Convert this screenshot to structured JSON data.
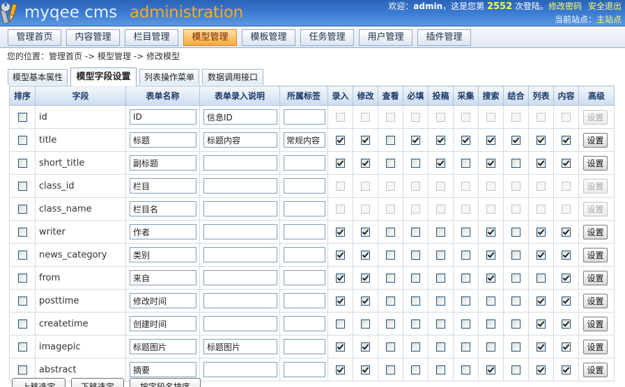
{
  "header": {
    "logo_icon": "tools-icon",
    "logo_main": "myqee cms",
    "logo_sub": "administration",
    "welcome_prefix": "欢迎：",
    "username": "admin",
    "welcome_mid": "，这是您第 ",
    "login_count": "2552",
    "welcome_suffix": " 次登陆。",
    "change_password": "修改密码",
    "logout": "安全退出",
    "site_label": "当前站点：",
    "site_name": "主站点"
  },
  "nav": {
    "tabs": [
      {
        "label": "管理首页",
        "active": false
      },
      {
        "label": "内容管理",
        "active": false
      },
      {
        "label": "栏目管理",
        "active": false
      },
      {
        "label": "模型管理",
        "active": true
      },
      {
        "label": "模板管理",
        "active": false
      },
      {
        "label": "任务管理",
        "active": false
      },
      {
        "label": "用户管理",
        "active": false
      },
      {
        "label": "插件管理",
        "active": false
      }
    ]
  },
  "breadcrumb": {
    "prefix": "您的位置：",
    "separator": " -> ",
    "items": [
      "管理首页",
      "模型管理",
      "修改模型"
    ]
  },
  "subtabs": [
    {
      "label": "模型基本属性",
      "active": false
    },
    {
      "label": "模型字段设置",
      "active": true
    },
    {
      "label": "列表操作菜单",
      "active": false
    },
    {
      "label": "数据调用接口",
      "active": false
    }
  ],
  "table": {
    "headers": [
      "排序",
      "字段",
      "表单名称",
      "表单录入说明",
      "所属标签",
      "录入",
      "修改",
      "查看",
      "必填",
      "投稿",
      "采集",
      "搜索",
      "结合",
      "列表",
      "内容",
      "高级"
    ],
    "settings_label": "设置",
    "rows": [
      {
        "field": "id",
        "form_name": "ID",
        "form_desc": "信息ID",
        "tag": "",
        "locked": true,
        "flags": [
          false,
          false,
          false,
          false,
          false,
          false,
          false,
          false,
          false,
          false
        ]
      },
      {
        "field": "title",
        "form_name": "标题",
        "form_desc": "标题内容",
        "tag": "常规内容",
        "locked": false,
        "flags": [
          true,
          true,
          false,
          true,
          true,
          true,
          true,
          true,
          true,
          true
        ]
      },
      {
        "field": "short_title",
        "form_name": "副标题",
        "form_desc": "",
        "tag": "",
        "locked": false,
        "flags": [
          true,
          true,
          false,
          false,
          true,
          false,
          true,
          false,
          true,
          true
        ]
      },
      {
        "field": "class_id",
        "form_name": "栏目",
        "form_desc": "",
        "tag": "",
        "locked": true,
        "flags": [
          false,
          false,
          false,
          false,
          false,
          false,
          false,
          false,
          false,
          false
        ]
      },
      {
        "field": "class_name",
        "form_name": "栏目名",
        "form_desc": "",
        "tag": "",
        "locked": true,
        "flags": [
          false,
          false,
          false,
          false,
          false,
          false,
          false,
          false,
          false,
          false
        ]
      },
      {
        "field": "writer",
        "form_name": "作者",
        "form_desc": "",
        "tag": "",
        "locked": false,
        "flags": [
          true,
          true,
          false,
          false,
          false,
          false,
          true,
          false,
          true,
          true
        ]
      },
      {
        "field": "news_category",
        "form_name": "类别",
        "form_desc": "",
        "tag": "",
        "locked": false,
        "flags": [
          true,
          true,
          false,
          false,
          false,
          false,
          true,
          false,
          true,
          true
        ]
      },
      {
        "field": "from",
        "form_name": "来自",
        "form_desc": "",
        "tag": "",
        "locked": false,
        "flags": [
          true,
          true,
          false,
          false,
          false,
          false,
          true,
          false,
          false,
          true
        ]
      },
      {
        "field": "posttime",
        "form_name": "修改时间",
        "form_desc": "",
        "tag": "",
        "locked": false,
        "flags": [
          true,
          true,
          false,
          false,
          false,
          false,
          false,
          false,
          true,
          true
        ]
      },
      {
        "field": "createtime",
        "form_name": "创建时间",
        "form_desc": "",
        "tag": "",
        "locked": false,
        "flags": [
          false,
          false,
          false,
          false,
          false,
          false,
          false,
          false,
          true,
          true
        ]
      },
      {
        "field": "imagepic",
        "form_name": "标题图片",
        "form_desc": "标题图片",
        "tag": "",
        "locked": false,
        "flags": [
          true,
          true,
          false,
          false,
          false,
          false,
          false,
          false,
          true,
          true
        ]
      },
      {
        "field": "abstract",
        "form_name": "摘要",
        "form_desc": "",
        "tag": "",
        "locked": false,
        "flags": [
          true,
          true,
          false,
          false,
          false,
          false,
          true,
          false,
          true,
          true
        ]
      }
    ]
  },
  "footer": {
    "buttons": [
      "上移选定",
      "下移选定",
      "按字段名排序"
    ]
  },
  "theme": {
    "header_blue": "#3b7bd2",
    "active_tab": "#f6a93a",
    "link_yellow": "#ffff66",
    "logo_orange": "#f6a91e"
  }
}
